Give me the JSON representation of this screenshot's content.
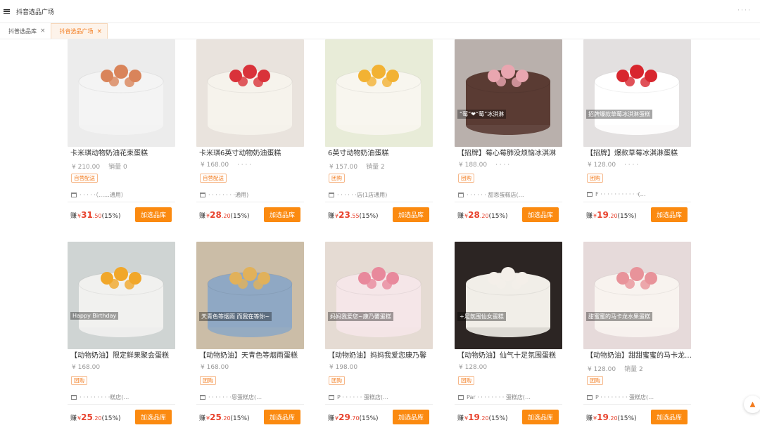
{
  "app": {
    "title": "抖音选品广场",
    "user": "· · · ·"
  },
  "tabs": [
    {
      "label": "抖普选品库",
      "close": "×"
    },
    {
      "label": "抖音选品广场",
      "close": "×"
    }
  ],
  "products": [
    {
      "title": "卡米琪动物奶油花束蛋糕",
      "price": "¥ 210.00",
      "sales": "销量 0",
      "badge": "自营配送",
      "shop": "· · · · ·（……通用）",
      "earn_label": "赚",
      "cur": "¥",
      "earn_int": "31",
      "earn_dec": ".50",
      "rate": "(15%)",
      "button": "加选品库"
    },
    {
      "title": "卡米琪6英寸动物奶油蛋糕",
      "price": "¥ 168.00",
      "sales": "· · · ·",
      "badge": "自营配送",
      "shop": "· · · · · · · ·通用)",
      "earn_label": "赚",
      "cur": "¥",
      "earn_int": "28",
      "earn_dec": ".20",
      "rate": "(15%)",
      "button": "加选品库"
    },
    {
      "title": "6英寸动物奶油蛋糕",
      "price": "¥ 157.00",
      "sales": "销量 2",
      "badge": "团购",
      "shop": "· · · · · ·店(1店通用)",
      "earn_label": "赚",
      "cur": "¥",
      "earn_int": "23",
      "earn_dec": ".55",
      "rate": "(15%)",
      "button": "加选品库"
    },
    {
      "title": "【招牌】莓心莓肺没烦恼冰淇淋",
      "price": "¥ 188.00",
      "sales": "· · · ·",
      "badge": "团购",
      "shop": "· · · · · · 甜恩蛋糕店(…",
      "earn_label": "赚",
      "cur": "¥",
      "earn_int": "28",
      "earn_dec": ".20",
      "rate": "(15%)",
      "button": "加选品库"
    },
    {
      "title": "【招牌】爆款草莓冰淇淋蛋糕",
      "price": "¥ 128.00",
      "sales": "· · · ·",
      "badge": "团购",
      "shop": "F · · · · · · · · · · ·(…",
      "earn_label": "赚",
      "cur": "¥",
      "earn_int": "19",
      "earn_dec": ".20",
      "rate": "(15%)",
      "button": "加选品库"
    },
    {
      "title": "【动物奶油】限定鲜果聚会蛋糕",
      "price": "¥ 168.00",
      "sales": "",
      "badge": "团购",
      "shop": "· · · · · · · · ·糕店(…",
      "earn_label": "赚",
      "cur": "¥",
      "earn_int": "25",
      "earn_dec": ".20",
      "rate": "(15%)",
      "button": "加选品库"
    },
    {
      "title": "【动物奶油】天青色等烟雨蛋糕",
      "price": "¥ 168.00",
      "sales": "",
      "badge": "团购",
      "shop": "· · · · · · ·恩蛋糕店(…",
      "earn_label": "赚",
      "cur": "¥",
      "earn_int": "25",
      "earn_dec": ".20",
      "rate": "(15%)",
      "button": "加选品库"
    },
    {
      "title": "【动物奶油】妈妈我爱您康乃馨",
      "price": "¥ 198.00",
      "sales": "",
      "badge": "团购",
      "shop": "P · · · · · · 蛋糕店(…",
      "earn_label": "赚",
      "cur": "¥",
      "earn_int": "29",
      "earn_dec": ".70",
      "rate": "(15%)",
      "button": "加选品库"
    },
    {
      "title": "【动物奶油】仙气十足氛围蛋糕",
      "price": "¥ 128.00",
      "sales": "",
      "badge": "团购",
      "shop": "Par · · · · · · · · 蛋糕店(…",
      "earn_label": "赚",
      "cur": "¥",
      "earn_int": "19",
      "earn_dec": ".20",
      "rate": "(15%)",
      "button": "加选品库"
    },
    {
      "title": "【动物奶油】甜甜蜜蜜的马卡龙水果蛋糕",
      "price": "¥ 128.00",
      "sales": "销量 2",
      "badge": "团购",
      "shop": "P · · · · · · · · 蛋糕店(…",
      "earn_label": "赚",
      "cur": "¥",
      "earn_int": "19",
      "earn_dec": ".20",
      "rate": "(15%)",
      "button": "加选品库"
    }
  ],
  "images": [
    {
      "icon": "flower-bouquet-cake-icon",
      "bg": "#ececec",
      "cake": "#f4f4f4",
      "top": "#d9845a",
      "caption": ""
    },
    {
      "icon": "green-strawberry-cake-icon",
      "bg": "#e9e3dd",
      "cake": "#f6f3ec",
      "top": "#d9323a",
      "caption": ""
    },
    {
      "icon": "fruit-mango-grape-cake-icon",
      "bg": "#e8ecd8",
      "cake": "#f8f6ef",
      "top": "#f2b233",
      "caption": ""
    },
    {
      "icon": "chocolate-strawberry-cake-icon",
      "bg": "#b9b0ac",
      "cake": "#5a3b33",
      "top": "#e9a6b0",
      "caption": "“莓”❤“莓”冰淇淋"
    },
    {
      "icon": "strawberry-cream-cake-icon",
      "bg": "#e3e0e0",
      "cake": "#ffffff",
      "top": "#d8262e",
      "caption": "招牌爆款草莓冰淇淋蛋糕"
    },
    {
      "icon": "mango-birthday-cake-icon",
      "bg": "#cfd4d3",
      "cake": "#f1f1ef",
      "top": "#f1a72a",
      "caption": "Happy Birthday"
    },
    {
      "icon": "blue-lemon-cake-icon",
      "bg": "#cbbda7",
      "cake": "#8fa8c4",
      "top": "#e1b15a",
      "caption": "天青色等烟雨 而我在等你~"
    },
    {
      "icon": "pink-carnation-cake-icon",
      "bg": "#e5dbd3",
      "cake": "#f5e6e8",
      "top": "#e8899c",
      "caption": "妈妈我爱您~康乃馨蛋糕"
    },
    {
      "icon": "candle-tulip-cake-icon",
      "bg": "#2c2523",
      "cake": "#f1eee8",
      "top": "#f4efe9",
      "caption": "+足氛围仙女蛋糕"
    },
    {
      "icon": "macaron-fruit-cake-icon",
      "bg": "#e6dada",
      "cake": "#f8f3ef",
      "top": "#e8939a",
      "caption": "甜蜜蜜的马卡龙水果蛋糕"
    }
  ]
}
